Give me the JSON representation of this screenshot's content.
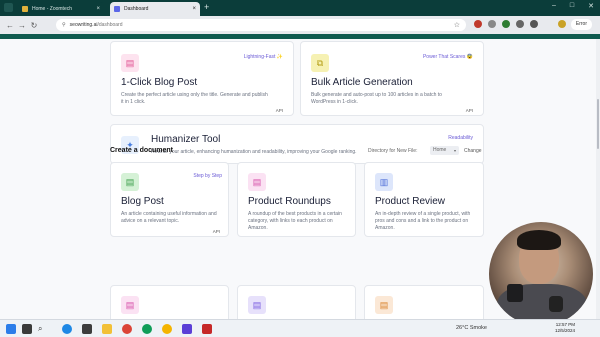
{
  "browser": {
    "tabs": [
      {
        "label": "Home - Zoomtech",
        "active": false,
        "favicon_color": "#e2b23c"
      },
      {
        "label": "Dashboard",
        "active": true,
        "favicon_color": "#5b67e8"
      }
    ],
    "address": {
      "host": "seowriting.ai",
      "path": "/dashboard"
    },
    "error_button": "Error"
  },
  "features": [
    {
      "title": "1-Click Blog Post",
      "badge": "Lightning-Fast ✨",
      "desc": "Create the perfect article using only the title. Generate and publish it in 1 click.",
      "api": "API",
      "icon": "document-icon",
      "icon_bg": "#fde3ef",
      "icon_fg": "#e04c8f"
    },
    {
      "title": "Bulk Article Generation",
      "badge": "Power That Scares 😨",
      "desc": "Bulk generate and auto-post up to 100 articles in a batch to WordPress in 1-click.",
      "api": "API",
      "icon": "bulk-icon",
      "icon_bg": "#f6f1b3",
      "icon_fg": "#b59f18"
    },
    {
      "title": "Humanizer Tool",
      "badge": "Readability",
      "desc": "Rewrite your article, enhancing humanization and readability, improving your Google ranking.",
      "icon": "sparkle-icon",
      "icon_bg": "#e7f0fd",
      "icon_fg": "#4a7fe0"
    }
  ],
  "create_section": {
    "title": "Create a document",
    "directory_label": "Directory for New File:",
    "directory_value": "Home",
    "change_label": "Change"
  },
  "documents": [
    {
      "title": "Blog Post",
      "badge": "Step by Step",
      "desc": "An article containing useful information and advice on a relevant topic.",
      "api": "API",
      "icon_bg": "#d5f1d6",
      "icon_fg": "#3a9d49"
    },
    {
      "title": "Product Roundups",
      "desc": "A roundup of the best products in a certain category, with links to each product on Amazon.",
      "icon_bg": "#fbe2f3",
      "icon_fg": "#d64ea8"
    },
    {
      "title": "Product Review",
      "desc": "An in-depth review of a single product, with pros and cons and a link to the product on Amazon.",
      "icon_bg": "#dde6fb",
      "icon_fg": "#4f6fd8"
    }
  ],
  "partial_row": [
    {
      "icon_bg": "#fbe2f3"
    },
    {
      "icon_bg": "#e7e1fb"
    },
    {
      "icon_bg": "#fbe8d6"
    }
  ],
  "taskbar": {
    "weather": "26°C Smoke",
    "time": "12:57 PM",
    "date": "12/5/2024"
  }
}
